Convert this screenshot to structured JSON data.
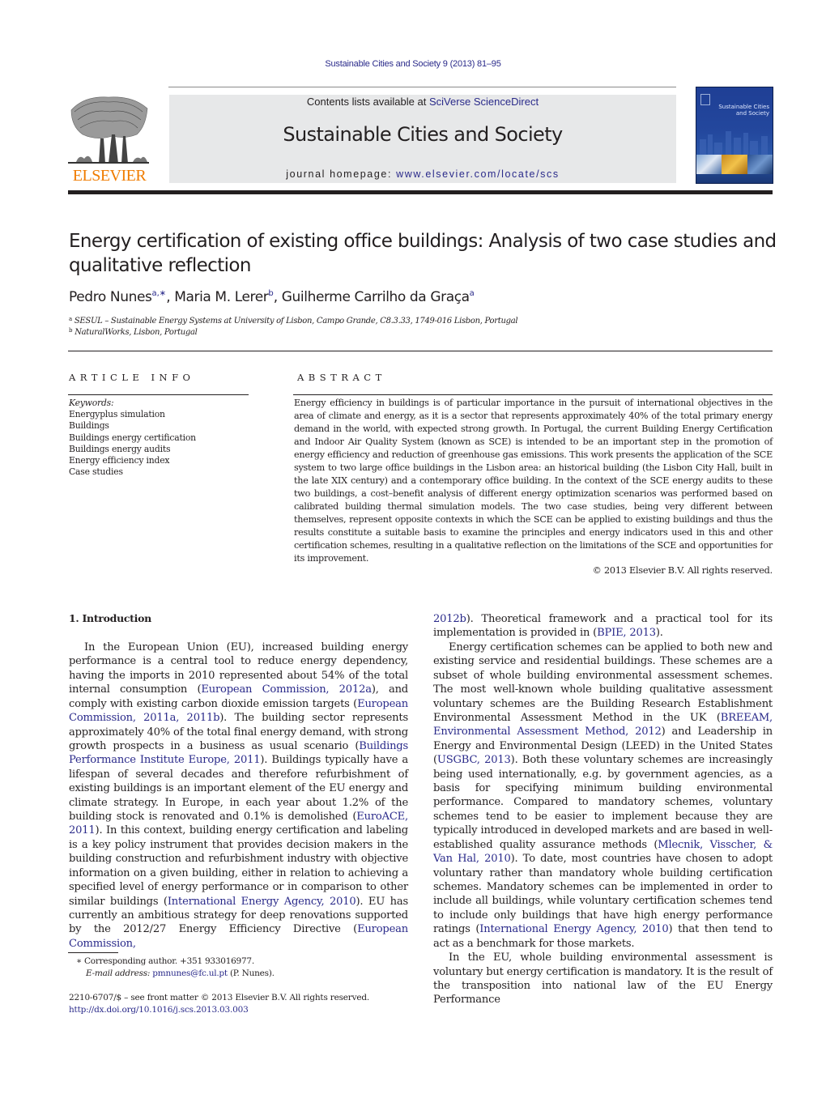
{
  "running_head": "Sustainable Cities and Society 9 (2013) 81–95",
  "publisher": {
    "logo_icon": "elsevier-tree-icon",
    "name": "ELSEVIER",
    "brand_color": "#f07c00"
  },
  "banner": {
    "contents_prefix": "Contents lists available at ",
    "contents_link": "SciVerse ScienceDirect",
    "journal_name": "Sustainable Cities and Society",
    "homepage_prefix": "journal homepage: ",
    "homepage_link": "www.elsevier.com/locate/scs"
  },
  "cover": {
    "icon": "journal-cover-image",
    "title_line1": "Sustainable Cities",
    "title_line2": "and Society"
  },
  "article": {
    "title": "Energy certification of existing office buildings: Analysis of two case studies and qualitative reflection",
    "authors": [
      {
        "name": "Pedro Nunes",
        "sup": "a,∗",
        "sep": ", "
      },
      {
        "name": "Maria M. Lerer",
        "sup": "b",
        "sep": ", "
      },
      {
        "name": "Guilherme Carrilho da Graça",
        "sup": "a",
        "sep": ""
      }
    ],
    "affiliations": [
      {
        "mark": "a",
        "text": "SESUL – Sustainable Energy Systems at University of Lisbon, Campo Grande, C8.3.33, 1749-016 Lisbon, Portugal"
      },
      {
        "mark": "b",
        "text": "NaturalWorks, Lisbon, Portugal"
      }
    ]
  },
  "article_info": {
    "heading": "ARTICLE INFO",
    "keywords_label": "Keywords:",
    "keywords": [
      "Energyplus simulation",
      "Buildings",
      "Buildings energy certification",
      "Buildings energy audits",
      "Energy efficiency index",
      "Case studies"
    ]
  },
  "abstract": {
    "heading": "ABSTRACT",
    "text": "Energy efficiency in buildings is of particular importance in the pursuit of international objectives in the area of climate and energy, as it is a sector that represents approximately 40% of the total primary energy demand in the world, with expected strong growth. In Portugal, the current Building Energy Certification and Indoor Air Quality System (known as SCE) is intended to be an important step in the promotion of energy efficiency and reduction of greenhouse gas emissions. This work presents the application of the SCE system to two large office buildings in the Lisbon area: an historical building (the Lisbon City Hall, built in the late XIX century) and a contemporary office building. In the context of the SCE energy audits to these two buildings, a cost–benefit analysis of different energy optimization scenarios was performed based on calibrated building thermal simulation models. The two case studies, being very different between themselves, represent opposite contexts in which the SCE can be applied to existing buildings and thus the results constitute a suitable basis to examine the principles and energy indicators used in this and other certification schemes, resulting in a qualitative reflection on the limitations of the SCE and opportunities for its improvement.",
    "copyright": "© 2013 Elsevier B.V. All rights reserved."
  },
  "body": {
    "section_heading": "1.  Introduction",
    "left_column": [
      {
        "indent": true,
        "segments": [
          {
            "t": "In the European Union (EU), increased building energy performance is a central tool to reduce energy dependency, having the imports in 2010 represented about 54% of the total internal consumption ("
          },
          {
            "t": "European Commission, 2012a",
            "link": true
          },
          {
            "t": "), and comply with existing carbon dioxide emission targets ("
          },
          {
            "t": "European Commission, 2011a, 2011b",
            "link": true
          },
          {
            "t": "). The building sector represents approximately 40% of the total final energy demand, with strong growth prospects in a business as usual scenario ("
          },
          {
            "t": "Buildings Performance Institute Europe, 2011",
            "link": true
          },
          {
            "t": "). Buildings typically have a lifespan of several decades and therefore refurbishment of existing buildings is an important element of the EU energy and climate strategy. In Europe, in each year about 1.2% of the building stock is renovated and 0.1% is demolished ("
          },
          {
            "t": "EuroACE, 2011",
            "link": true
          },
          {
            "t": "). In this context, building energy certification and labeling is a key policy instrument that provides decision makers in the building construction and refurbishment industry with objective information on a given building, either in relation to achieving a specified level of energy performance or in comparison to other similar buildings ("
          },
          {
            "t": "International Energy Agency, 2010",
            "link": true
          },
          {
            "t": "). EU has currently an ambitious strategy for deep renovations supported by the 2012/27 Energy Efficiency Directive ("
          },
          {
            "t": "European Commission,",
            "link": true
          }
        ]
      }
    ],
    "right_column": [
      {
        "indent": false,
        "segments": [
          {
            "t": "2012b",
            "link": true
          },
          {
            "t": "). Theoretical framework and a practical tool for its implementation is provided in ("
          },
          {
            "t": "BPIE, 2013",
            "link": true
          },
          {
            "t": ")."
          }
        ]
      },
      {
        "indent": true,
        "segments": [
          {
            "t": "Energy certification schemes can be applied to both new and existing service and residential buildings. These schemes are a subset of whole building environmental assessment schemes. The most well-known whole building qualitative assessment voluntary schemes are the Building Research Establishment Environmental Assessment Method in the UK ("
          },
          {
            "t": "BREEAM, Environmental Assessment Method, 2012",
            "link": true
          },
          {
            "t": ") and Leadership in Energy and Environmental Design (LEED) in the United States ("
          },
          {
            "t": "USGBC, 2013",
            "link": true
          },
          {
            "t": "). Both these voluntary schemes are increasingly being used internationally, e.g. by government agencies, as a basis for specifying minimum building environmental performance. Compared to mandatory schemes, voluntary schemes tend to be easier to implement because they are typically introduced in developed markets and are based in well-established quality assurance methods ("
          },
          {
            "t": "Mlecnik, Visscher, & Van Hal, 2010",
            "link": true
          },
          {
            "t": "). To date, most countries have chosen to adopt voluntary rather than mandatory whole building certification schemes. Mandatory schemes can be implemented in order to include all buildings, while voluntary certification schemes tend to include only buildings that have high energy performance ratings ("
          },
          {
            "t": "International Energy Agency, 2010",
            "link": true
          },
          {
            "t": ") that then tend to act as a benchmark for those markets."
          }
        ]
      },
      {
        "indent": true,
        "segments": [
          {
            "t": "In the EU, whole building environmental assessment is voluntary but energy certification is mandatory. It is the result of the transposition into national law of the EU Energy Performance"
          }
        ]
      }
    ]
  },
  "footnotes": {
    "corresponding": "∗  Corresponding author. +351 933016977.",
    "email_label": "E-mail address:",
    "email": "pmnunes@fc.ul.pt",
    "email_suffix": " (P. Nunes).",
    "front_matter": "2210-6707/$ – see front matter © 2013 Elsevier B.V. All rights reserved.",
    "doi": "http://dx.doi.org/10.1016/j.scs.2013.03.003"
  },
  "colors": {
    "link": "#2a2a8a",
    "text": "#231f20",
    "banner_bg": "#e7e8e9",
    "cover_blue": "#23479d"
  }
}
